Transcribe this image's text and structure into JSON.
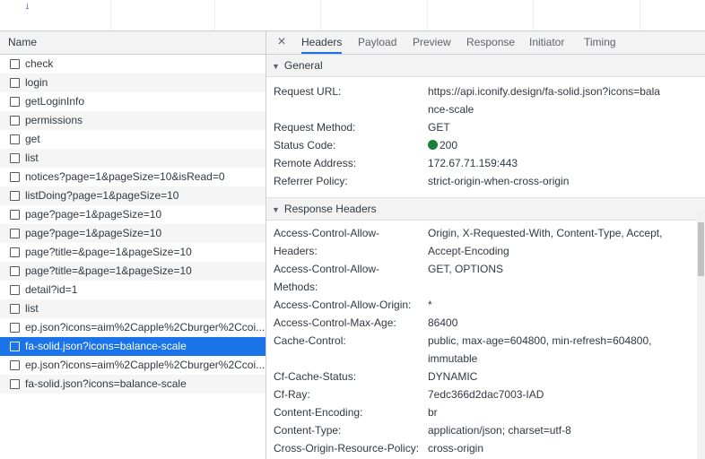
{
  "network_list": {
    "header": "Name",
    "rows": [
      {
        "name": "check",
        "selected": false
      },
      {
        "name": "login",
        "selected": false
      },
      {
        "name": "getLoginInfo",
        "selected": false
      },
      {
        "name": "permissions",
        "selected": false
      },
      {
        "name": "get",
        "selected": false
      },
      {
        "name": "list",
        "selected": false
      },
      {
        "name": "notices?page=1&pageSize=10&isRead=0",
        "selected": false
      },
      {
        "name": "listDoing?page=1&pageSize=10",
        "selected": false
      },
      {
        "name": "page?page=1&pageSize=10",
        "selected": false
      },
      {
        "name": "page?page=1&pageSize=10",
        "selected": false
      },
      {
        "name": "page?title=&page=1&pageSize=10",
        "selected": false
      },
      {
        "name": "page?title=&page=1&pageSize=10",
        "selected": false
      },
      {
        "name": "detail?id=1",
        "selected": false
      },
      {
        "name": "list",
        "selected": false
      },
      {
        "name": "ep.json?icons=aim%2Capple%2Cburger%2Ccoi...",
        "selected": false
      },
      {
        "name": "fa-solid.json?icons=balance-scale",
        "selected": true
      },
      {
        "name": "ep.json?icons=aim%2Capple%2Cburger%2Ccoi...",
        "selected": false
      },
      {
        "name": "fa-solid.json?icons=balance-scale",
        "selected": false
      }
    ]
  },
  "detail": {
    "close_icon": "×",
    "tabs": [
      "Headers",
      "Payload",
      "Preview",
      "Response",
      "Initiator",
      "Timing"
    ],
    "active_tab": "Headers",
    "general": {
      "title": "General",
      "request_url_key": "Request URL:",
      "request_url_value": "https://api.iconify.design/fa-solid.json?icons=balance-scale",
      "request_method_key": "Request Method:",
      "request_method_value": "GET",
      "status_code_key": "Status Code:",
      "status_code_value": "200",
      "status_color": "#188038",
      "remote_address_key": "Remote Address:",
      "remote_address_value": "172.67.71.159:443",
      "referrer_policy_key": "Referrer Policy:",
      "referrer_policy_value": "strict-origin-when-cross-origin"
    },
    "response_headers": {
      "title": "Response Headers",
      "acao_headers_key": "Access-Control-Allow-Headers:",
      "acao_headers_value": "Origin, X-Requested-With, Content-Type, Accept, Accept-Encoding",
      "acao_methods_key": "Access-Control-Allow-Methods:",
      "acao_methods_value": "GET, OPTIONS",
      "acao_origin_key": "Access-Control-Allow-Origin:",
      "acao_origin_value": "*",
      "max_age_key": "Access-Control-Max-Age:",
      "max_age_value": "86400",
      "cache_control_key": "Cache-Control:",
      "cache_control_value": "public, max-age=604800, min-refresh=604800, immutable",
      "cf_cache_status_key": "Cf-Cache-Status:",
      "cf_cache_status_value": "DYNAMIC",
      "cf_ray_key": "Cf-Ray:",
      "cf_ray_value": "7edc366d2dac7003-IAD",
      "content_encoding_key": "Content-Encoding:",
      "content_encoding_value": "br",
      "content_type_key": "Content-Type:",
      "content_type_value": "application/json; charset=utf-8",
      "corp_key": "Cross-Origin-Resource-Policy:",
      "corp_value": "cross-origin"
    }
  },
  "colors": {
    "selection": "#1a73e8",
    "panel_bg": "#f3f3f3",
    "border": "#cacdd1"
  }
}
